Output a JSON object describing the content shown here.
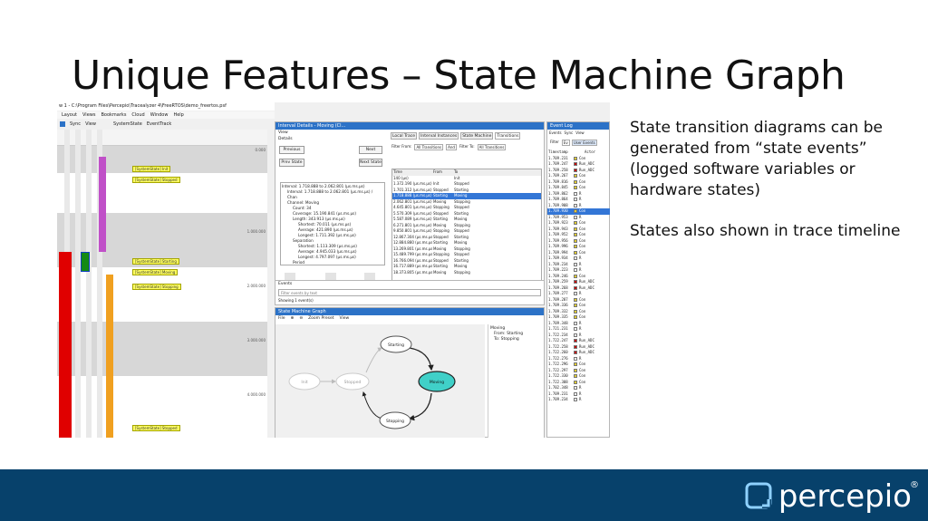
{
  "slide": {
    "title": "Unique Features – State Machine Graph",
    "bullet1": "State transition diagrams can be generated from “state events” (logged software variables or hardware states)",
    "bullet2": "States also shown in trace timeline",
    "logo": "percepio",
    "logo_reg": "®",
    "colors": {
      "footer": "#07416b",
      "accent": "#2c72c7",
      "tag": "#ffff60",
      "red": "#e00000",
      "node_moving": "#40d0c8"
    }
  },
  "app": {
    "window_title": "w 1 - C:\\Program Files\\Percepio\\Tracealyzer 4\\FreeRTOS\\demo_freertos.psf",
    "menu": [
      "Layout",
      "Views",
      "Bookmarks",
      "Cloud",
      "Window",
      "Help"
    ],
    "toolbar": {
      "sync": "Sync",
      "view": "View",
      "col1": "SystemState",
      "col2": "EventTrack"
    },
    "timeline": {
      "ticks": [
        "0.000",
        "1.000.000",
        "2.000.000",
        "3.000.000",
        "4.000.000"
      ],
      "tags": [
        "[SystemState] Init",
        "[SystemState] Stopped",
        "[SystemState] Starting",
        "[SystemState] Moving",
        "[SystemState] Stopping",
        "[SystemState] Stopped"
      ],
      "col_labels": [
        "Stopped",
        "Starting",
        "Moving",
        "Stopping"
      ]
    },
    "details": {
      "title": "Interval Details - Moving (Cl...",
      "view": "View",
      "header": "Details",
      "previous": "Previous",
      "next": "Next",
      "prev_state": "Prev State",
      "next_state": "Next State",
      "tabs": [
        "Local Trace",
        "Interval Instances",
        "State Machine",
        "Transitions"
      ],
      "filter_from": "Filter From:",
      "filter_to": "Filter To:",
      "all_transitions": "All Transitions",
      "and": "And",
      "tree": [
        "Interval: 1.718.888 to 2.062.801 (µs.ms.µs)",
        "Interval: 1.718.888 to 2.062.801 (µs.ms.µs) / Chan",
        "Channel: Moving",
        "Count: 34",
        "Coverage: 15.190.841 (µs.ms.µs)",
        "Length: 343.913 (µs.ms.µs)",
        "Shortest: 70.011 (µs.ms.µs)",
        "Average: 421.890 (µs.ms.µs)",
        "Longest: 1.711.392 (µs.ms.µs)",
        "Separation",
        "Shortest: 1.113.309 (µs.ms.µs)",
        "Average: 4.945.033 (µs.ms.µs)",
        "Longest: 4.797.097 (µs.ms.µs)",
        "Period"
      ],
      "table_headers": [
        "Time",
        "From",
        "To"
      ],
      "table_rows": [
        [
          "140 (µs)",
          "",
          "Init"
        ],
        [
          "1.372.190 (µs.ms.µs)",
          "Init",
          "Stopped"
        ],
        [
          "1.701.312 (µs.ms.µs)",
          "Stopped",
          "Starting"
        ],
        [
          "1.718.888 (µs.ms.µs)",
          "Starting",
          "Moving"
        ],
        [
          "2.062.801 (µs.ms.µs)",
          "Moving",
          "Stopping"
        ],
        [
          "4.645.801 (µs.ms.µs)",
          "Stopping",
          "Stopped"
        ],
        [
          "5.570.309 (µs.ms.µs)",
          "Stopped",
          "Starting"
        ],
        [
          "5.587.089 (µs.ms.µs)",
          "Starting",
          "Moving"
        ],
        [
          "6.271.801 (µs.ms.µs)",
          "Moving",
          "Stopping"
        ],
        [
          "9.850.801 (µs.ms.µs)",
          "Stopping",
          "Stopped"
        ],
        [
          "12.867.304 (µs.ms.µs)",
          "Stopped",
          "Starting"
        ],
        [
          "12.884.880 (µs.ms.µs)",
          "Starting",
          "Moving"
        ],
        [
          "13.269.801 (µs.ms.µs)",
          "Moving",
          "Stopping"
        ],
        [
          "15.489.799 (µs.ms.µs)",
          "Stopping",
          "Stopped"
        ],
        [
          "16.766.094 (µs.ms.µs)",
          "Stopped",
          "Starting"
        ],
        [
          "16.717.889 (µs.ms.µs)",
          "Starting",
          "Moving"
        ],
        [
          "18.373.805 (µs.ms.µs)",
          "Moving",
          "Stopping"
        ]
      ]
    },
    "events": {
      "header": "Events",
      "filter_placeholder": "Filter events by text",
      "showing": "Showing 1 event(s)"
    },
    "smg": {
      "title": "State Machine Graph",
      "menu": [
        "File",
        "Zoom Preset",
        "View"
      ],
      "nodes": [
        "Init",
        "Stopped",
        "Starting",
        "Moving",
        "Stopping"
      ],
      "side": [
        "Moving",
        "From: Starting",
        "To: Stopping"
      ]
    },
    "evlog": {
      "title": "Event Log",
      "tb": [
        "Events",
        "Sync",
        "View"
      ],
      "filter": [
        "Filter",
        "Ev",
        "User Events"
      ],
      "headers": [
        "Timestamp",
        "Actor"
      ],
      "rows": [
        [
          "1.709.231",
          "Con"
        ],
        [
          "1.709.247",
          "Run_ADC"
        ],
        [
          "1.709.258",
          "Run_ADC"
        ],
        [
          "1.709.267",
          "Con"
        ],
        [
          "1.709.816",
          "Con"
        ],
        [
          "1.709.845",
          "Con"
        ],
        [
          "1.709.862",
          "R"
        ],
        [
          "1.709.864",
          "R"
        ],
        [
          "1.709.908",
          "R"
        ],
        [
          "1.709.930",
          "Con"
        ],
        [
          "1.709.953",
          "R"
        ],
        [
          "1.709.923",
          "Con"
        ],
        [
          "1.709.943",
          "Con"
        ],
        [
          "1.709.952",
          "Con"
        ],
        [
          "1.709.956",
          "Con"
        ],
        [
          "1.709.996",
          "Con"
        ],
        [
          "1.709.994",
          "Con"
        ],
        [
          "1.709.934",
          "R"
        ],
        [
          "1.709.234",
          "R"
        ],
        [
          "1.709.223",
          "R"
        ],
        [
          "1.709.246",
          "Con"
        ],
        [
          "1.709.259",
          "Run_ADC"
        ],
        [
          "1.709.268",
          "Run_ADC"
        ],
        [
          "1.709.277",
          "R"
        ],
        [
          "1.709.287",
          "Con"
        ],
        [
          "1.709.336",
          "Con"
        ],
        [
          "1.709.332",
          "Con"
        ],
        [
          "1.709.335",
          "Con"
        ],
        [
          "1.709.348",
          "R"
        ],
        [
          "1.721.231",
          "R"
        ],
        [
          "1.722.234",
          "R"
        ],
        [
          "1.722.247",
          "Run_ADC"
        ],
        [
          "1.722.258",
          "Run_ADC"
        ],
        [
          "1.722.260",
          "Run_ADC"
        ],
        [
          "1.722.276",
          "R"
        ],
        [
          "1.722.296",
          "Con"
        ],
        [
          "1.722.297",
          "Con"
        ],
        [
          "1.722.330",
          "Con"
        ],
        [
          "1.722.308",
          "Con"
        ],
        [
          "1.702.348",
          "R"
        ],
        [
          "1.709.231",
          "R"
        ],
        [
          "1.709.234",
          "R"
        ]
      ]
    }
  }
}
